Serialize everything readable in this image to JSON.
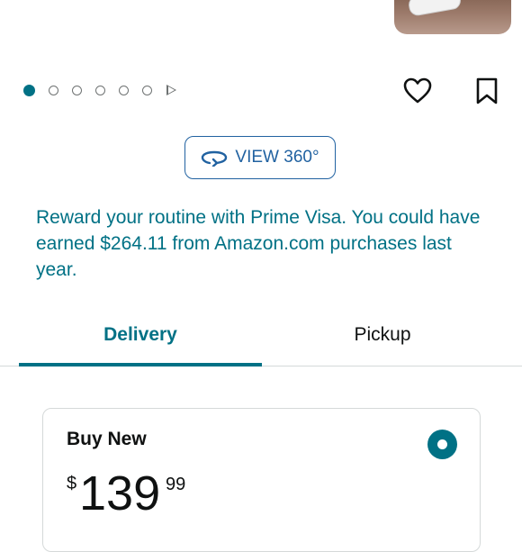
{
  "product": {
    "image_alt": "product photo (partially visible)"
  },
  "carousel": {
    "dot_count": 6,
    "active_index": 0,
    "has_video": true
  },
  "actions": {
    "wishlist_icon": "heart-icon",
    "save_icon": "bookmark-icon"
  },
  "view360": {
    "label": "VIEW 360°",
    "icon": "rotate-360-icon"
  },
  "promo": {
    "text": "Reward your routine with Prime Visa. You could have earned $264.11 from Amazon.com purchases last year."
  },
  "tabs": [
    {
      "label": "Delivery",
      "selected": true
    },
    {
      "label": "Pickup",
      "selected": false
    }
  ],
  "buy_new": {
    "title": "Buy New",
    "selected": true,
    "price": {
      "symbol": "$",
      "whole": "139",
      "fraction": "99"
    }
  },
  "colors": {
    "accent": "#007185",
    "link_blue": "#2162a1",
    "text": "#0f1111",
    "border": "#d5d9d9"
  }
}
